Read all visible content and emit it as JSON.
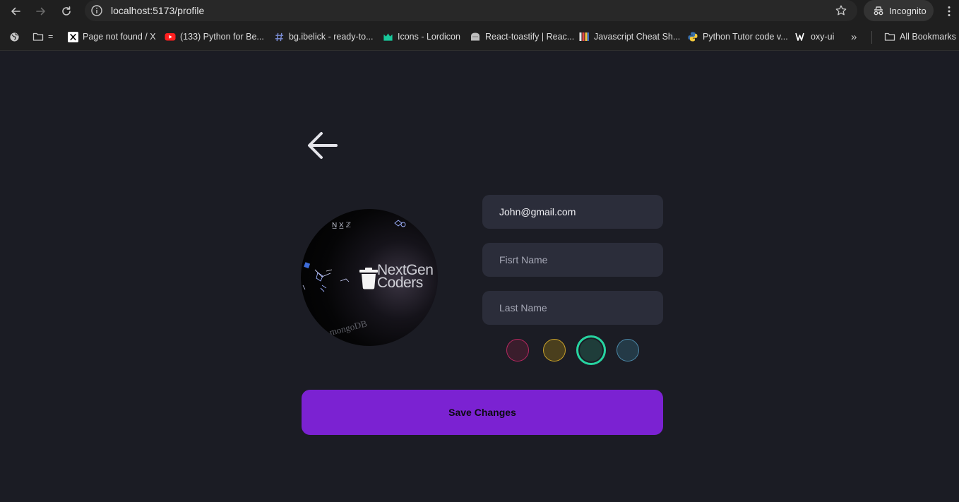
{
  "browser": {
    "url": "localhost:5173/profile",
    "incognito_label": "Incognito",
    "bookmarks": [
      {
        "label": "=",
        "icon": "folder-icon"
      },
      {
        "label": "Page not found / X",
        "icon": "x-logo-icon"
      },
      {
        "label": "(133) Python for Be...",
        "icon": "youtube-icon"
      },
      {
        "label": "bg.ibelick - ready-to...",
        "icon": "hash-icon"
      },
      {
        "label": "Icons - Lordicon",
        "icon": "lordicon-icon"
      },
      {
        "label": "React-toastify | Reac...",
        "icon": "toastify-icon"
      },
      {
        "label": "Javascript Cheat Sh...",
        "icon": "books-icon"
      },
      {
        "label": "Python Tutor code v...",
        "icon": "python-icon"
      },
      {
        "label": "oxy-ui",
        "icon": "w-logo-icon"
      }
    ],
    "more_label": "»",
    "all_bookmarks_label": "All Bookmarks"
  },
  "profile": {
    "avatar_brand_line1": "NextGen",
    "avatar_brand_line2": "Coders",
    "avatar_text_mongo": "mongoDB",
    "email_value": "John@gmail.com",
    "first_name_placeholder": "Fisrt Name",
    "last_name_placeholder": "Last Name",
    "colors": [
      {
        "name": "pink",
        "fill": "#3a1d2c",
        "border": "#b5275f",
        "selected": false
      },
      {
        "name": "yellow",
        "fill": "#4a3f1d",
        "border": "#c8a12a",
        "selected": false
      },
      {
        "name": "teal",
        "fill": "#1f3d3a",
        "border": "#27d3a0",
        "selected": true
      },
      {
        "name": "blue",
        "fill": "#243a47",
        "border": "#4a86a6",
        "selected": false
      }
    ],
    "save_label": "Save Changes"
  },
  "icons": {
    "back": "arrow-left-icon",
    "delete_avatar": "trash-icon"
  }
}
